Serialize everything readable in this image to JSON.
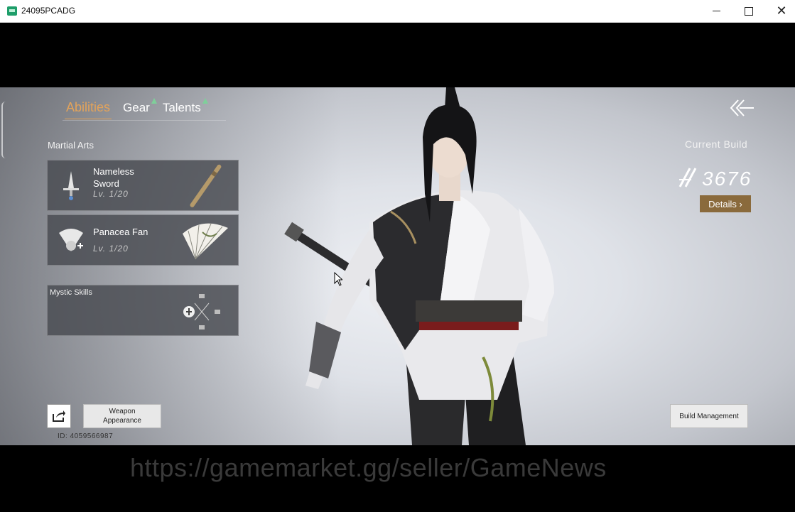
{
  "window": {
    "title": "24095PCADG",
    "controls": {
      "minimize": "minimize-icon",
      "maximize": "maximize-icon",
      "close": "close-icon"
    }
  },
  "tabs": [
    {
      "label": "Abilities",
      "active": true,
      "has_indicator": false
    },
    {
      "label": "Gear",
      "active": false,
      "has_indicator": true
    },
    {
      "label": "Talents",
      "active": false,
      "has_indicator": true
    }
  ],
  "martial_arts": {
    "section_label": "Martial Arts",
    "items": [
      {
        "name_line1": "Nameless",
        "name_line2": "Sword",
        "level": "Lv. 1/20",
        "icon": "sword-icon",
        "weapon_art": "staff-icon"
      },
      {
        "name_line1": "Panacea Fan",
        "name_line2": "",
        "level": "Lv. 1/20",
        "icon": "fan-skill-icon",
        "weapon_art": "fan-icon"
      }
    ]
  },
  "mystic": {
    "label": "Mystic Skills",
    "icon": "mystic-cross-icon"
  },
  "build": {
    "label": "Current Build",
    "score": "3676",
    "details_label": "Details ›"
  },
  "bottom": {
    "weapon_appearance_line1": "Weapon",
    "weapon_appearance_line2": "Appearance",
    "player_id": "ID: 4059566987",
    "build_management_label": "Build Management"
  },
  "watermark": "https://gamemarket.gg/seller/GameNews",
  "colors": {
    "accent_active_tab": "#e3a35a",
    "tab_indicator": "#7fcf9a",
    "details_button": "#8a6a3c"
  }
}
